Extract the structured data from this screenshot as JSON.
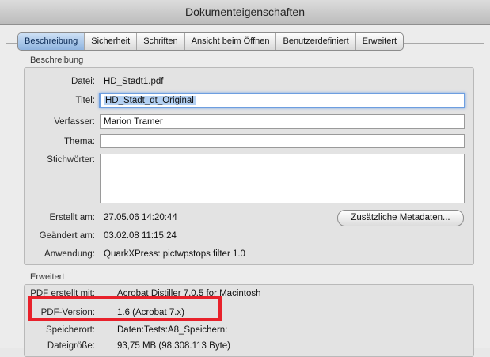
{
  "window": {
    "title": "Dokumenteigenschaften"
  },
  "tabs": [
    {
      "label": "Beschreibung",
      "active": true
    },
    {
      "label": "Sicherheit",
      "active": false
    },
    {
      "label": "Schriften",
      "active": false
    },
    {
      "label": "Ansicht beim Öffnen",
      "active": false
    },
    {
      "label": "Benutzerdefiniert",
      "active": false
    },
    {
      "label": "Erweitert",
      "active": false
    }
  ],
  "beschreibung": {
    "heading": "Beschreibung",
    "datei_label": "Datei:",
    "datei_value": "HD_Stadt1.pdf",
    "titel_label": "Titel:",
    "titel_value": "HD_Stadt_dt_Original",
    "verfasser_label": "Verfasser:",
    "verfasser_value": "Marion Tramer",
    "thema_label": "Thema:",
    "thema_value": "",
    "stichwoerter_label": "Stichwörter:",
    "stichwoerter_value": "",
    "erstellt_label": "Erstellt am:",
    "erstellt_value": "27.05.06 14:20:44",
    "geaendert_label": "Geändert am:",
    "geaendert_value": "03.02.08 11:15:24",
    "anwendung_label": "Anwendung:",
    "anwendung_value": "QuarkXPress: pictwpstops filter 1.0",
    "metadata_button": "Zusätzliche Metadaten..."
  },
  "erweitert": {
    "heading": "Erweitert",
    "pdf_erstellt_label": "PDF erstellt mit:",
    "pdf_erstellt_value": "Acrobat Distiller 7.0.5 for Macintosh",
    "pdf_version_label": "PDF-Version:",
    "pdf_version_value": "1.6 (Acrobat 7.x)",
    "speicherort_label": "Speicherort:",
    "speicherort_value": "Daten:Tests:A8_Speichern:",
    "dateigroesse_label": "Dateigröße:",
    "dateigroesse_value": "93,75 MB (98.308.113 Byte)"
  },
  "colors": {
    "highlight_box": "#e8212b",
    "active_tab": "#8fb4e0",
    "focus_ring": "#6d9ee0"
  }
}
